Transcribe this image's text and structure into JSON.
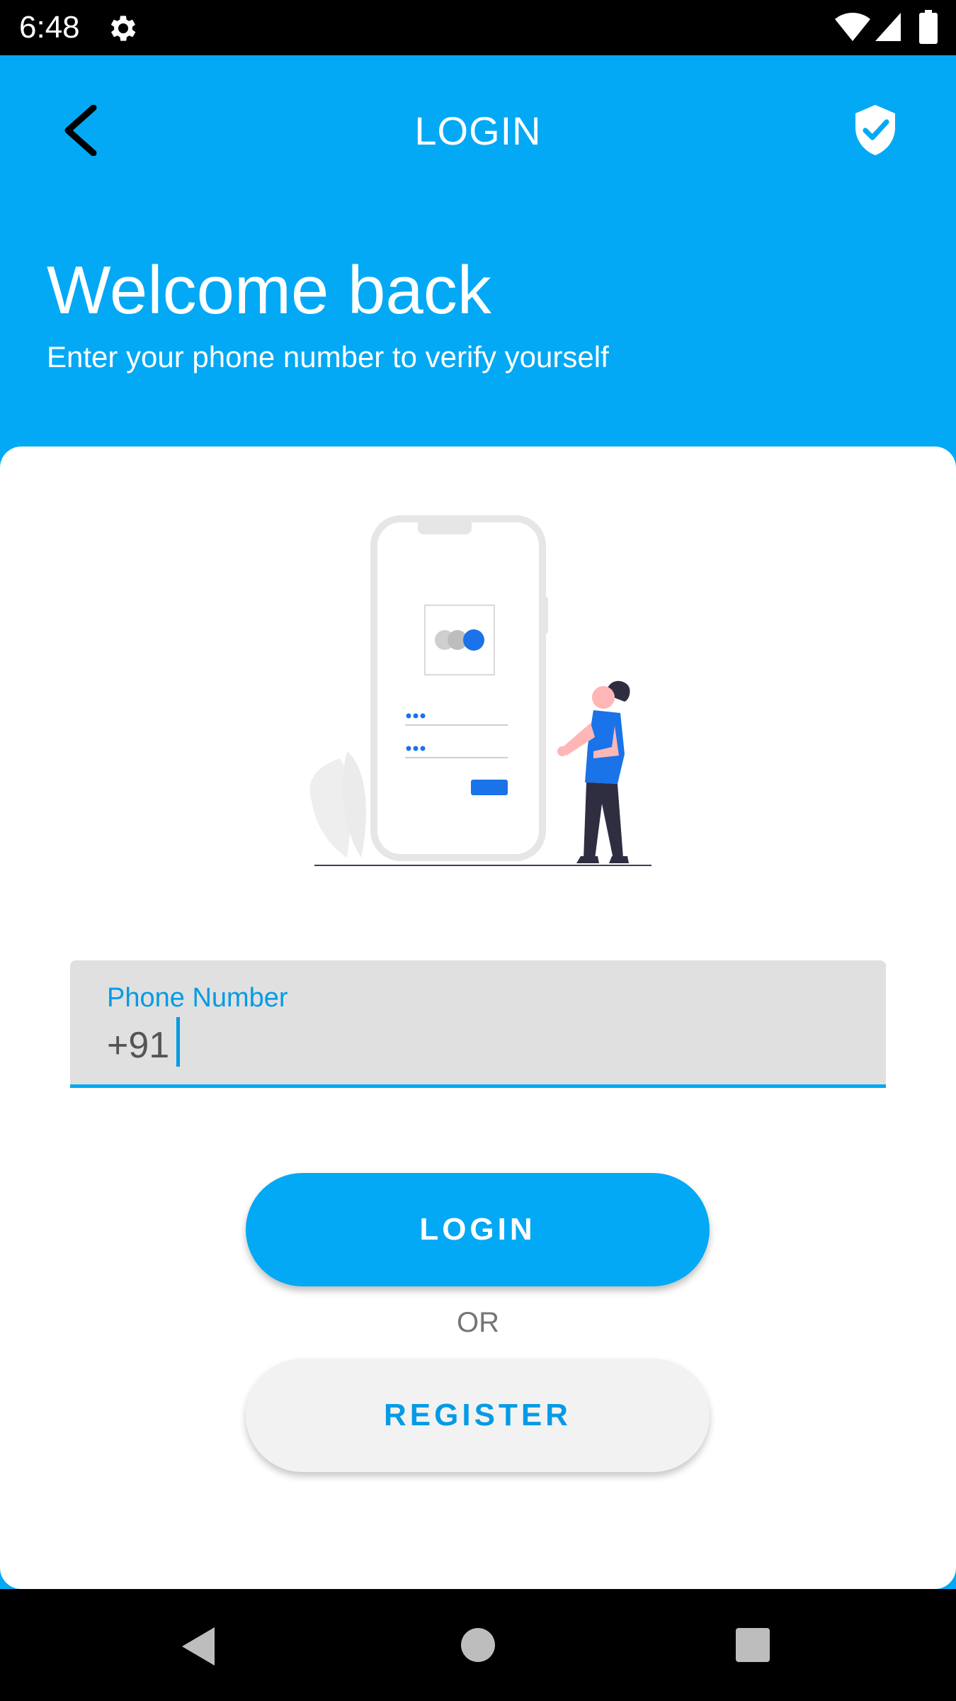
{
  "status_bar": {
    "time": "6:48",
    "icons": [
      "gear-icon",
      "wifi-icon",
      "signal-icon",
      "battery-icon"
    ]
  },
  "app_bar": {
    "title": "LOGIN",
    "back_icon": "back-arrow-icon",
    "action_icon": "shield-check-icon"
  },
  "header": {
    "title": "Welcome back",
    "subtitle": "Enter your phone number to verify yourself"
  },
  "form": {
    "phone_label": "Phone Number",
    "phone_value": "+91"
  },
  "buttons": {
    "login_label": "LOGIN",
    "or_text": "OR",
    "register_label": "REGISTER"
  },
  "nav_bar": {
    "icons": [
      "nav-back-icon",
      "nav-home-icon",
      "nav-recents-icon"
    ]
  },
  "colors": {
    "primary": "#03A9F4",
    "accent_dark": "#039BE5",
    "illustration_blue": "#1A73E8",
    "field_bg": "#E0E0E0",
    "secondary_button_bg": "#F2F2F2"
  }
}
